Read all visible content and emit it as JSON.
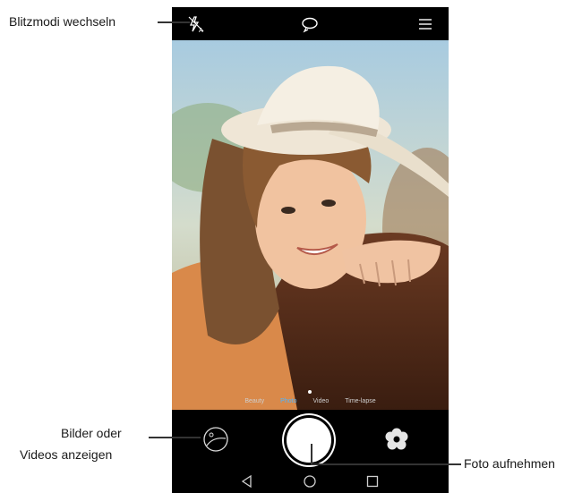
{
  "annotations": {
    "flash": "Blitzmodi wechseln",
    "gallery_line1": "Bilder oder",
    "gallery_line2": "Videos anzeigen",
    "shutter": "Foto aufnehmen"
  },
  "camera": {
    "modes": [
      "Beauty",
      "Photo",
      "Video",
      "Time-lapse"
    ],
    "active_mode": "Photo"
  },
  "icons": {
    "flash": "flash-auto-icon",
    "switch_camera": "switch-camera-icon",
    "menu": "menu-icon",
    "gallery": "gallery-thumbnail-icon",
    "filter": "filter-flower-icon",
    "back": "back-triangle-icon",
    "home": "home-circle-icon",
    "recents": "recents-square-icon"
  }
}
